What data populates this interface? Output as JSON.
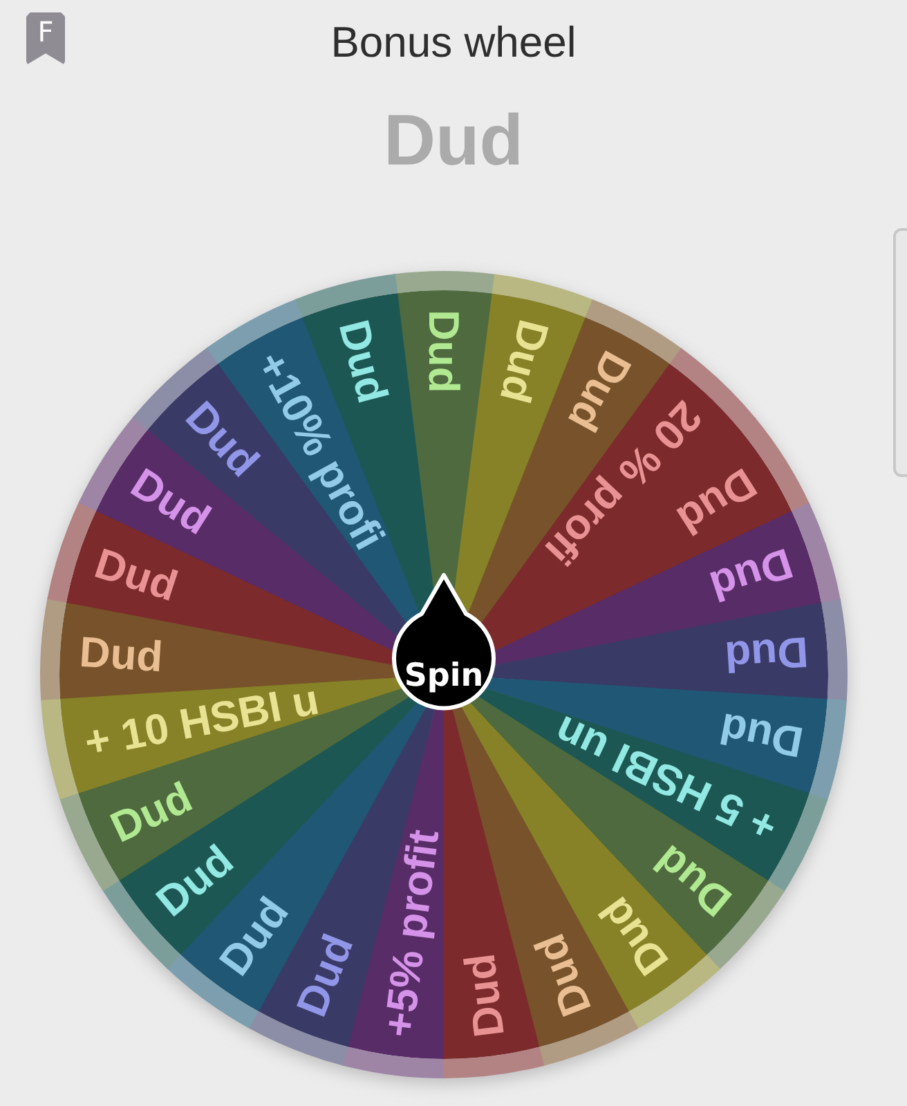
{
  "header": {
    "badge": "F",
    "title": "Bonus wheel"
  },
  "result": "Dud",
  "wheel": {
    "button": "Spin",
    "segments": [
      {
        "label": "Dud",
        "color": "#4e6a3e"
      },
      {
        "label": "Dud",
        "color": "#878227"
      },
      {
        "label": "Dud",
        "color": "#77522a"
      },
      {
        "label": "20 % profi",
        "color": "#7c2a2b"
      },
      {
        "label": "Dud",
        "color": "#7c2a2b"
      },
      {
        "label": "Dud",
        "color": "#582c66"
      },
      {
        "label": "Dud",
        "color": "#393b66"
      },
      {
        "label": "Dud",
        "color": "#1f5774"
      },
      {
        "label": "+ 5 HSBI un",
        "color": "#1d5753"
      },
      {
        "label": "Dud",
        "color": "#4e6a3e"
      },
      {
        "label": "Dud",
        "color": "#878227"
      },
      {
        "label": "Dud",
        "color": "#77522a"
      },
      {
        "label": "Dud",
        "color": "#7c2a2b"
      },
      {
        "label": "+5% profit",
        "color": "#582c66"
      },
      {
        "label": "Dud",
        "color": "#393b66"
      },
      {
        "label": "Dud",
        "color": "#1f5774"
      },
      {
        "label": "Dud",
        "color": "#1d5753"
      },
      {
        "label": "Dud",
        "color": "#4e6a3e"
      },
      {
        "label": "+ 10 HSBI u",
        "color": "#878227"
      },
      {
        "label": "Dud",
        "color": "#77522a"
      },
      {
        "label": "Dud",
        "color": "#7c2a2b"
      },
      {
        "label": "Dud",
        "color": "#582c66"
      },
      {
        "label": "Dud",
        "color": "#393b66"
      },
      {
        "label": "+10% profi",
        "color": "#1f5774"
      },
      {
        "label": "Dud",
        "color": "#1d5753"
      }
    ]
  }
}
